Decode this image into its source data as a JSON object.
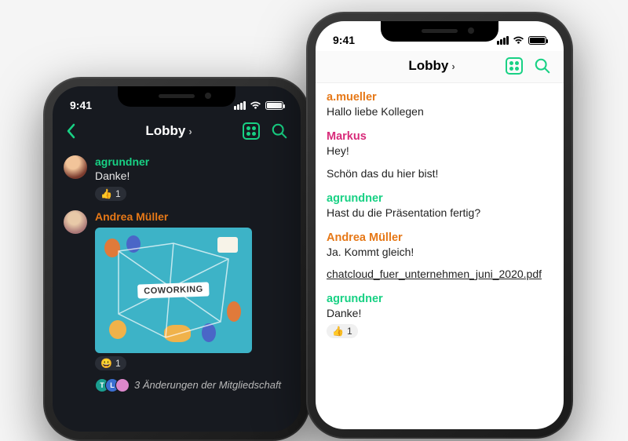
{
  "status": {
    "time": "9:41"
  },
  "nav": {
    "title": "Lobby",
    "grid_icon": "grid",
    "search_icon": "search"
  },
  "dark": {
    "messages": [
      {
        "sender": "agrundner",
        "senderColor": "teal",
        "text": "Danke!",
        "reaction": {
          "emoji": "👍",
          "count": "1"
        }
      },
      {
        "sender": "Andrea Müller",
        "senderColor": "orange",
        "image_label": "COWORKING",
        "reaction": {
          "emoji": "😀",
          "count": "1"
        }
      }
    ],
    "membership": "3 Änderungen der Mitgliedschaft"
  },
  "light": {
    "messages": [
      {
        "sender": "a.mueller",
        "senderColor": "orange",
        "text": "Hallo liebe Kollegen"
      },
      {
        "sender": "Markus",
        "senderColor": "pink",
        "text": "Hey!",
        "text2": "Schön das du hier bist!"
      },
      {
        "sender": "agrundner",
        "senderColor": "teal",
        "text": "Hast du die Präsentation fertig?"
      },
      {
        "sender": "Andrea Müller",
        "senderColor": "orange",
        "text": "Ja. Kommt gleich!",
        "file": "chatcloud_fuer_unternehmen_juni_2020.pdf"
      },
      {
        "sender": "agrundner",
        "senderColor": "teal",
        "text": "Danke!",
        "reaction": {
          "emoji": "👍",
          "count": "1"
        }
      }
    ]
  }
}
